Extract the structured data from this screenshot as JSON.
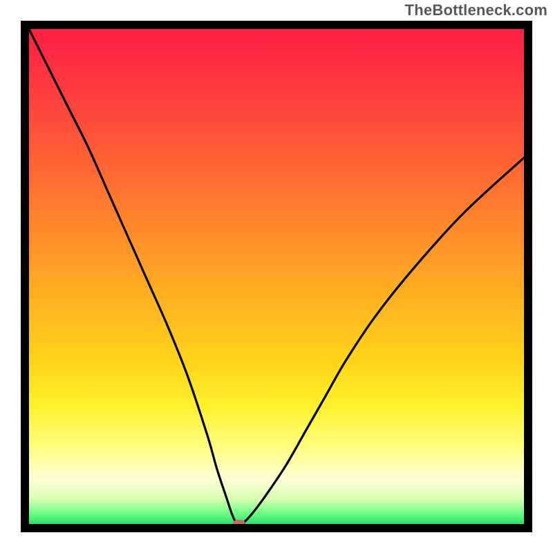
{
  "watermark": "TheBottleneck.com",
  "chart_data": {
    "type": "line",
    "title": "",
    "xlabel": "",
    "ylabel": "",
    "xlim": [
      0,
      100
    ],
    "ylim": [
      0,
      100
    ],
    "grid": false,
    "legend": false,
    "background": {
      "type": "vertical-gradient",
      "stops": [
        {
          "pos": 0,
          "color": "#ff1f43"
        },
        {
          "pos": 24,
          "color": "#ff5a36"
        },
        {
          "pos": 46,
          "color": "#ff9a27"
        },
        {
          "pos": 67,
          "color": "#ffd319"
        },
        {
          "pos": 84,
          "color": "#ffff7a"
        },
        {
          "pos": 95,
          "color": "#d6ffb0"
        },
        {
          "pos": 100,
          "color": "#29e26b"
        }
      ]
    },
    "series": [
      {
        "name": "bottleneck-curve",
        "color": "#000000",
        "x": [
          0,
          4,
          8,
          12,
          16,
          20,
          24,
          28,
          32,
          36,
          38,
          40,
          41,
          42,
          43,
          45,
          48,
          52,
          56,
          60,
          64,
          70,
          78,
          88,
          100
        ],
        "y": [
          100,
          92,
          84,
          76,
          67,
          58,
          49,
          40,
          30,
          18,
          11,
          5,
          2,
          0,
          0,
          2,
          6,
          12,
          19,
          26,
          33,
          42,
          52,
          63,
          74
        ]
      }
    ],
    "marker": {
      "name": "optimal-point",
      "x": 42.5,
      "y": 0,
      "color": "#c86a60",
      "shape": "rounded-rect"
    }
  }
}
